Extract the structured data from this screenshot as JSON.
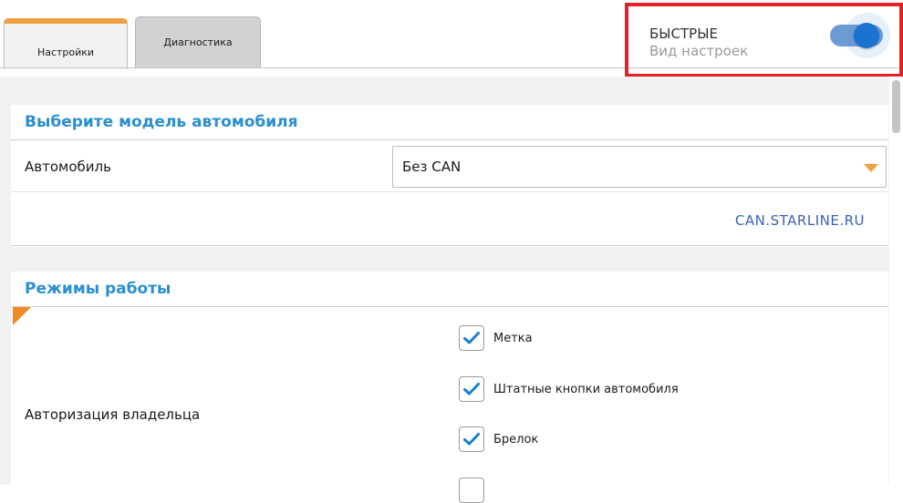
{
  "tabs": [
    {
      "label": "Настройки",
      "active": true
    },
    {
      "label": "Диагностика",
      "active": false
    }
  ],
  "settings_mode": {
    "title": "БЫСТРЫЕ",
    "subtitle": "Вид настроек",
    "toggle_on": true
  },
  "car_model": {
    "heading": "Выберите модель автомобиля",
    "field_label": "Автомобиль",
    "selected_value": "Без CAN",
    "link_text": "CAN.STARLINE.RU"
  },
  "operation_modes": {
    "heading": "Режимы работы",
    "auth_label": "Авторизация владельца",
    "options": [
      {
        "label": "Метка",
        "checked": true
      },
      {
        "label": "Штатные кнопки автомобиля",
        "checked": true
      },
      {
        "label": "Брелок",
        "checked": true
      }
    ]
  },
  "colors": {
    "accent_blue": "#2a8fd0",
    "accent_orange": "#f0a040",
    "highlight_red": "#e32127",
    "toggle_blue": "#1a73d0"
  }
}
